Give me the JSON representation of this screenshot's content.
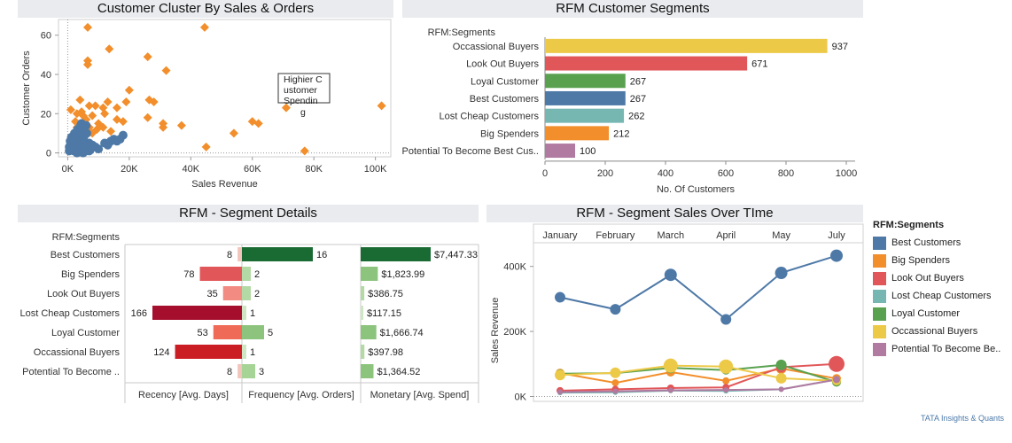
{
  "titles": {
    "cluster": "Customer Cluster By Sales & Orders",
    "rfm_segments": "RFM Customer Segments",
    "segment_details": "RFM - Segment Details",
    "sales_over_time": "RFM - Segment Sales Over TIme"
  },
  "legend": {
    "title": "RFM:Segments",
    "items": [
      {
        "label": "Best Customers",
        "color": "#4e79a7"
      },
      {
        "label": "Big Spenders",
        "color": "#f28e2b"
      },
      {
        "label": "Look Out Buyers",
        "color": "#e15759"
      },
      {
        "label": "Lost Cheap Customers",
        "color": "#76b7b2"
      },
      {
        "label": "Loyal Customer",
        "color": "#59a14f"
      },
      {
        "label": "Occassional Buyers",
        "color": "#edc948"
      },
      {
        "label": "Potential To Become Be..",
        "color": "#b07aa1"
      }
    ]
  },
  "footer": "TATA Insights & Quants",
  "chart_data": [
    {
      "type": "scatter",
      "title": "Customer Cluster By Sales & Orders",
      "xlabel": "Sales Revenue",
      "ylabel": "Customer Orders",
      "xlim": [
        -3000,
        105000
      ],
      "ylim": [
        -2,
        68
      ],
      "xticks": [
        {
          "v": 0,
          "label": "0K"
        },
        {
          "v": 20000,
          "label": "20K"
        },
        {
          "v": 40000,
          "label": "40K"
        },
        {
          "v": 60000,
          "label": "60K"
        },
        {
          "v": 80000,
          "label": "80K"
        },
        {
          "v": 100000,
          "label": "100K"
        }
      ],
      "yticks": [
        0,
        20,
        40,
        60
      ],
      "annotation": "Highier C ustomer Spendin g",
      "series": [
        {
          "color": "#f28e2b",
          "shape": "diamond",
          "points": [
            [
              6500,
              64
            ],
            [
              44500,
              64
            ],
            [
              6500,
              47
            ],
            [
              6500,
              45
            ],
            [
              13500,
              53
            ],
            [
              26000,
              49
            ],
            [
              32000,
              42
            ],
            [
              20000,
              32
            ],
            [
              19000,
              26
            ],
            [
              26500,
              27
            ],
            [
              28000,
              26
            ],
            [
              26000,
              18
            ],
            [
              31000,
              15
            ],
            [
              31000,
              13
            ],
            [
              37000,
              14
            ],
            [
              4000,
              27
            ],
            [
              7000,
              24
            ],
            [
              9000,
              24
            ],
            [
              11500,
              23
            ],
            [
              13000,
              26
            ],
            [
              16000,
              23
            ],
            [
              16000,
              17
            ],
            [
              18000,
              16
            ],
            [
              12000,
              20
            ],
            [
              8000,
              19
            ],
            [
              6000,
              17
            ],
            [
              4500,
              21
            ],
            [
              1000,
              22
            ],
            [
              3000,
              20
            ],
            [
              5000,
              19
            ],
            [
              2500,
              16
            ],
            [
              4500,
              14
            ],
            [
              7000,
              13
            ],
            [
              9500,
              12
            ],
            [
              11500,
              13
            ],
            [
              14000,
              11
            ],
            [
              8000,
              10
            ],
            [
              60000,
              16
            ],
            [
              62000,
              15
            ],
            [
              71000,
              23
            ],
            [
              102000,
              24
            ],
            [
              54000,
              10
            ],
            [
              45000,
              3
            ],
            [
              77000,
              1
            ],
            [
              3000,
              13
            ],
            [
              6000,
              11
            ],
            [
              10000,
              15
            ]
          ]
        },
        {
          "color": "#4e79a7",
          "shape": "circle",
          "points": [
            [
              500,
              1
            ],
            [
              1000,
              2
            ],
            [
              1500,
              3
            ],
            [
              2000,
              1
            ],
            [
              2500,
              4
            ],
            [
              3000,
              2
            ],
            [
              3500,
              5
            ],
            [
              4000,
              3
            ],
            [
              4500,
              6
            ],
            [
              5000,
              2
            ],
            [
              5500,
              4
            ],
            [
              6000,
              1
            ],
            [
              6500,
              3
            ],
            [
              7000,
              5
            ],
            [
              1000,
              5
            ],
            [
              2000,
              7
            ],
            [
              3000,
              8
            ],
            [
              4000,
              10
            ],
            [
              5000,
              12
            ],
            [
              6000,
              14
            ],
            [
              4500,
              15
            ],
            [
              5500,
              9
            ],
            [
              3500,
              11
            ],
            [
              2500,
              6
            ],
            [
              1500,
              4
            ],
            [
              7500,
              2
            ],
            [
              8000,
              4
            ],
            [
              9000,
              3
            ],
            [
              10000,
              2
            ],
            [
              12000,
              5
            ],
            [
              13000,
              4
            ],
            [
              14000,
              6
            ],
            [
              15000,
              7
            ],
            [
              16000,
              6
            ],
            [
              17000,
              7
            ],
            [
              18000,
              9
            ],
            [
              500,
              3
            ],
            [
              800,
              6
            ],
            [
              1200,
              8
            ],
            [
              2200,
              10
            ],
            [
              3200,
              12
            ],
            [
              4200,
              14
            ],
            [
              5200,
              8
            ],
            [
              6200,
              10
            ],
            [
              3000,
              0
            ],
            [
              5000,
              0
            ],
            [
              7000,
              1
            ]
          ]
        }
      ]
    },
    {
      "type": "bar",
      "title": "RFM Customer Segments",
      "orientation": "horizontal",
      "category_header": "RFM:Segments",
      "xlabel": "No. Of Customers",
      "xlim": [
        0,
        1000
      ],
      "xticks": [
        0,
        200,
        400,
        600,
        800,
        1000
      ],
      "categories": [
        "Occassional Buyers",
        "Look Out Buyers",
        "Loyal Customer",
        "Best Customers",
        "Lost Cheap Customers",
        "Big Spenders",
        "Potential To Become Best Cus.."
      ],
      "values": [
        937,
        671,
        267,
        267,
        262,
        212,
        100
      ],
      "colors": [
        "#edc948",
        "#e15759",
        "#59a14f",
        "#4e79a7",
        "#76b7b2",
        "#f28e2b",
        "#b07aa1"
      ]
    },
    {
      "type": "table",
      "title": "RFM - Segment Details",
      "category_header": "RFM:Segments",
      "categories": [
        "Best Customers",
        "Big Spenders",
        "Look Out Buyers",
        "Lost Cheap Customers",
        "Loyal Customer",
        "Occassional Buyers",
        "Potential To Become .."
      ],
      "columns": [
        {
          "name": "Recency [Avg. Days]",
          "values": [
            8,
            78,
            35,
            166,
            53,
            124,
            8
          ],
          "labels": [
            "8",
            "78",
            "35",
            "166",
            "53",
            "124",
            "8"
          ],
          "max": 166,
          "colors": [
            "#f2c4bd",
            "#e15759",
            "#f28b82",
            "#a50f2d",
            "#ef6a57",
            "#cb1e24",
            "#f2c4bd"
          ]
        },
        {
          "name": "Frequency [Avg. Orders]",
          "values": [
            16,
            2,
            2,
            1,
            5,
            1,
            3
          ],
          "labels": [
            "16",
            "2",
            "2",
            "1",
            "5",
            "1",
            "3"
          ],
          "max": 16,
          "colors": [
            "#1a6b33",
            "#b3d9a5",
            "#b3d9a5",
            "#cfe6c5",
            "#8cc47e",
            "#cfe6c5",
            "#a6d396"
          ]
        },
        {
          "name": "Monetary [Avg. Spend]",
          "values": [
            7447.33,
            1823.99,
            386.75,
            117.15,
            1666.74,
            397.98,
            1364.52
          ],
          "labels": [
            "$7,447.33",
            "$1,823.99",
            "$386.75",
            "$117.15",
            "$1,666.74",
            "$397.98",
            "$1,364.52"
          ],
          "max": 7447.33,
          "colors": [
            "#1a6b33",
            "#8cc47e",
            "#b3d9a5",
            "#cfe6c5",
            "#8cc47e",
            "#b3d9a5",
            "#8cc47e"
          ]
        }
      ]
    },
    {
      "type": "line",
      "title": "RFM - Segment Sales Over TIme",
      "ylabel": "Sales Revenue",
      "x": [
        "January",
        "February",
        "March",
        "April",
        "May",
        "July"
      ],
      "ylim": [
        -15000,
        470000
      ],
      "yticks": [
        {
          "v": 0,
          "label": "0K"
        },
        {
          "v": 200000,
          "label": "200K"
        },
        {
          "v": 400000,
          "label": "400K"
        }
      ],
      "series": [
        {
          "name": "Best Customers",
          "color": "#4e79a7",
          "values": [
            305000,
            268000,
            374000,
            237000,
            380000,
            433000
          ],
          "sizes": [
            6,
            6,
            7,
            6,
            7,
            7
          ]
        },
        {
          "name": "Big Spenders",
          "color": "#f28e2b",
          "values": [
            72000,
            42000,
            75000,
            48000,
            86000,
            55000
          ],
          "sizes": [
            5,
            4,
            5,
            4,
            6,
            5
          ]
        },
        {
          "name": "Look Out Buyers",
          "color": "#e15759",
          "values": [
            18000,
            22000,
            26000,
            28000,
            90000,
            100000
          ],
          "sizes": [
            4,
            4,
            4,
            4,
            6,
            9
          ]
        },
        {
          "name": "Lost Cheap Customers",
          "color": "#76b7b2",
          "values": [
            12000,
            13000,
            18000,
            17000,
            22000,
            52000
          ],
          "sizes": [
            3,
            3,
            3,
            3,
            3,
            4
          ]
        },
        {
          "name": "Loyal Customer",
          "color": "#59a14f",
          "values": [
            70000,
            72000,
            88000,
            81000,
            97000,
            44000
          ],
          "sizes": [
            5,
            5,
            6,
            5,
            6,
            5
          ]
        },
        {
          "name": "Occassional Buyers",
          "color": "#edc948",
          "values": [
            66000,
            73000,
            95000,
            92000,
            56000,
            48000
          ],
          "sizes": [
            6,
            6,
            8,
            8,
            6,
            5
          ]
        },
        {
          "name": "Potential To Become Be..",
          "color": "#b07aa1",
          "values": [
            14000,
            16000,
            19000,
            20000,
            22000,
            52000
          ],
          "sizes": [
            3,
            3,
            3,
            3,
            3,
            4
          ]
        }
      ]
    }
  ]
}
